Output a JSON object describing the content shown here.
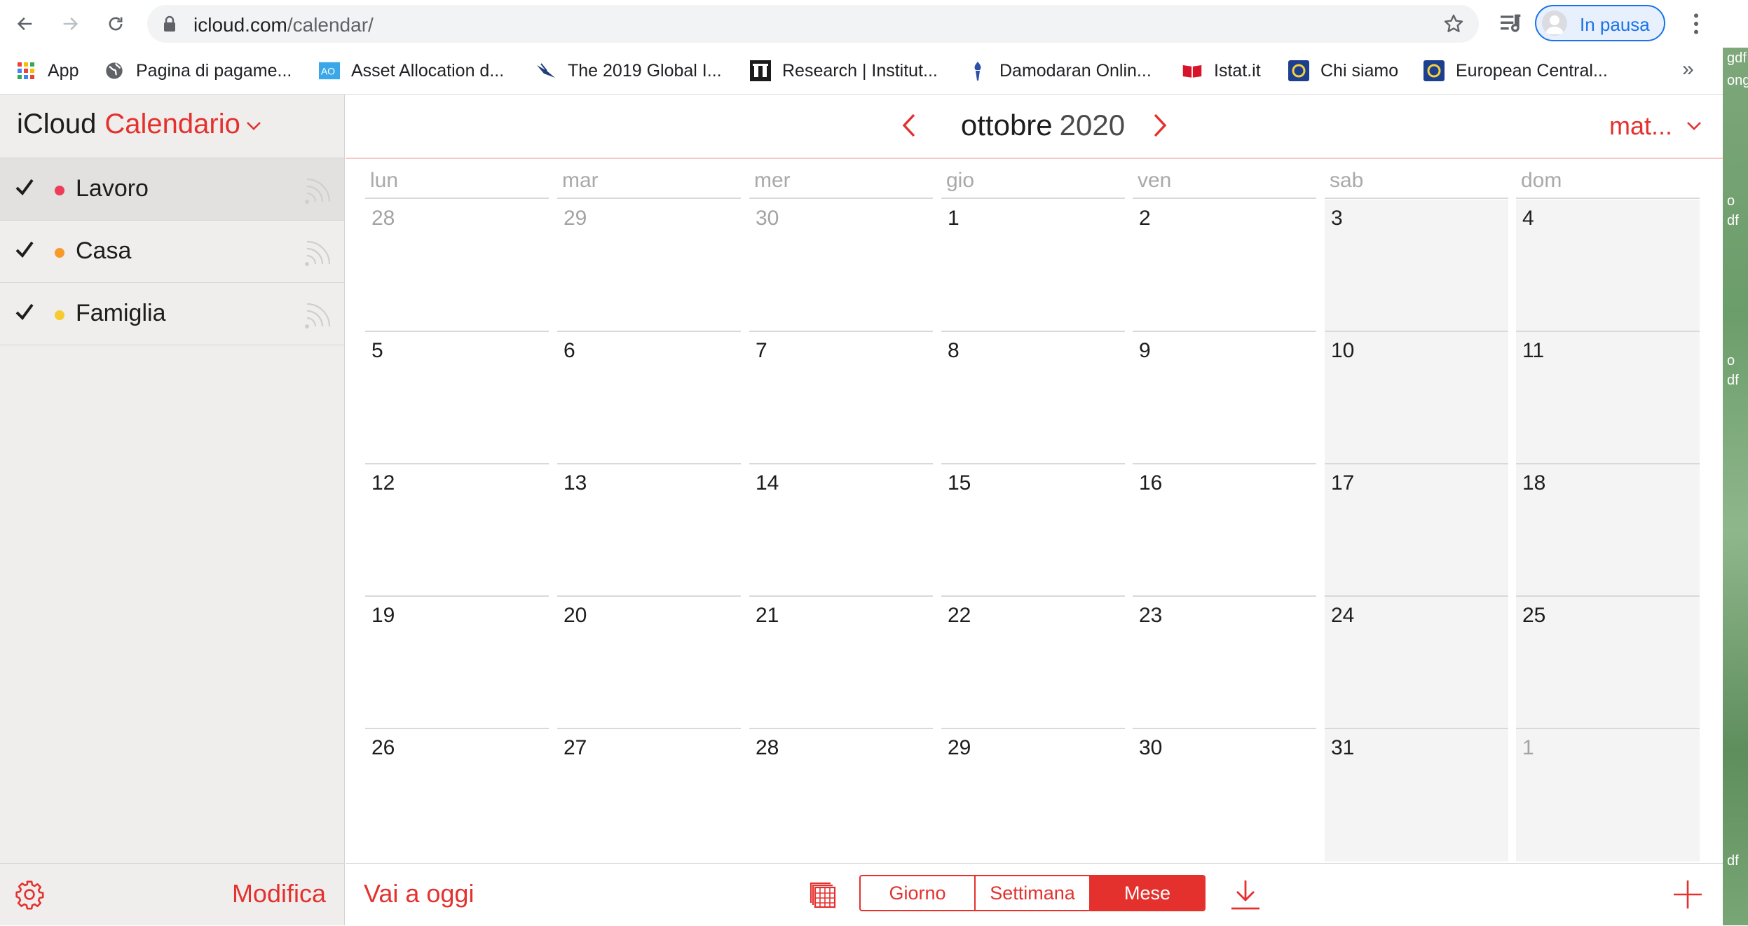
{
  "browser": {
    "url_host": "icloud.com",
    "url_path": "/calendar/",
    "profile_label": "In pausa",
    "bookmarks": [
      {
        "label": "App",
        "icon": "apps-grid-icon"
      },
      {
        "label": "Pagina di pagame...",
        "icon": "globe-icon"
      },
      {
        "label": "Asset Allocation d...",
        "icon": "ao-logo-icon"
      },
      {
        "label": "The 2019 Global I...",
        "icon": "bird-logo-icon"
      },
      {
        "label": "Research | Institut...",
        "icon": "ii-logo-icon"
      },
      {
        "label": "Damodaran Onlin...",
        "icon": "torch-icon"
      },
      {
        "label": "Istat.it",
        "icon": "istat-logo-icon"
      },
      {
        "label": "Chi siamo",
        "icon": "ecb-logo-icon"
      },
      {
        "label": "European Central...",
        "icon": "ecb-logo-icon"
      }
    ],
    "more_label": "»"
  },
  "desktop": {
    "fragments": [
      "gdf",
      "ong",
      "o",
      "df",
      "o",
      "df",
      "df"
    ]
  },
  "sidebar": {
    "brand_prefix": "iCloud",
    "brand_app": "Calendario",
    "calendars": [
      {
        "name": "Lavoro",
        "color": "#ee3d5a",
        "checked": true,
        "selected": true
      },
      {
        "name": "Casa",
        "color": "#f89a2b",
        "checked": true,
        "selected": false
      },
      {
        "name": "Famiglia",
        "color": "#f7cb2f",
        "checked": true,
        "selected": false
      }
    ],
    "edit_label": "Modifica"
  },
  "header": {
    "month": "ottobre",
    "year": "2020",
    "user_short": "mat..."
  },
  "calendar": {
    "weekdays": [
      "lun",
      "mar",
      "mer",
      "gio",
      "ven",
      "sab",
      "dom"
    ],
    "weeks": [
      [
        {
          "d": "28",
          "other": true
        },
        {
          "d": "29",
          "other": true
        },
        {
          "d": "30",
          "other": true
        },
        {
          "d": "1"
        },
        {
          "d": "2"
        },
        {
          "d": "3"
        },
        {
          "d": "4"
        }
      ],
      [
        {
          "d": "5"
        },
        {
          "d": "6"
        },
        {
          "d": "7"
        },
        {
          "d": "8"
        },
        {
          "d": "9"
        },
        {
          "d": "10"
        },
        {
          "d": "11"
        }
      ],
      [
        {
          "d": "12"
        },
        {
          "d": "13"
        },
        {
          "d": "14"
        },
        {
          "d": "15"
        },
        {
          "d": "16"
        },
        {
          "d": "17"
        },
        {
          "d": "18"
        }
      ],
      [
        {
          "d": "19"
        },
        {
          "d": "20"
        },
        {
          "d": "21"
        },
        {
          "d": "22"
        },
        {
          "d": "23"
        },
        {
          "d": "24"
        },
        {
          "d": "25"
        }
      ],
      [
        {
          "d": "26"
        },
        {
          "d": "27"
        },
        {
          "d": "28"
        },
        {
          "d": "29"
        },
        {
          "d": "30"
        },
        {
          "d": "31"
        },
        {
          "d": "1",
          "other": true
        }
      ]
    ]
  },
  "footer": {
    "today_label": "Vai a oggi",
    "views": [
      {
        "label": "Giorno",
        "active": false
      },
      {
        "label": "Settimana",
        "active": false
      },
      {
        "label": "Mese",
        "active": true
      }
    ]
  },
  "colors": {
    "accent": "#e4312e",
    "link_blue": "#1a73e8"
  }
}
